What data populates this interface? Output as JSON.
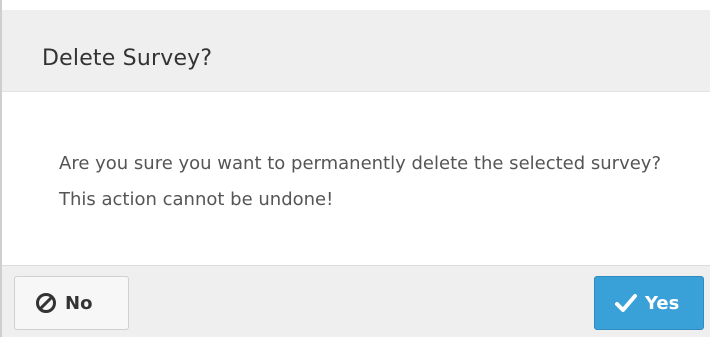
{
  "dialog": {
    "title": "Delete Survey?",
    "message": "Are you sure you want to permanently delete the selected survey? This action cannot be undone!",
    "no_label": "No",
    "yes_label": "Yes",
    "no_icon": "ban-icon",
    "yes_icon": "checkmark-icon"
  },
  "colors": {
    "header_bg": "#efefef",
    "primary_button": "#3aa0d8",
    "text": "#555555"
  }
}
